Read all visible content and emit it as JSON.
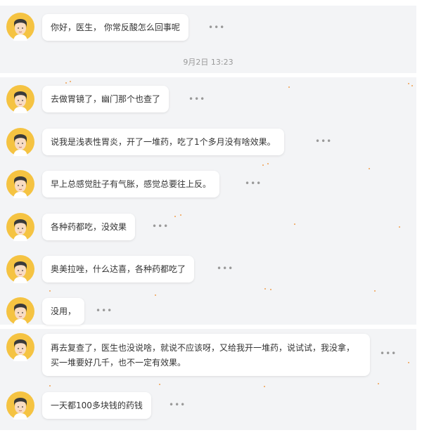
{
  "messages": [
    {
      "text": "你好，医生， 你常反酸怎么回事呢"
    },
    {
      "text": "去做胃镜了，幽门那个也查了"
    },
    {
      "text": "说我是浅表性胃炎，开了一堆药，吃了1个多月没有啥效果。"
    },
    {
      "text": "早上总感觉肚子有气胀，感觉总要往上反。"
    },
    {
      "text": "各种药都吃，没效果"
    },
    {
      "text": "奥美拉唑，什么达喜，各种药都吃了"
    },
    {
      "text": "没用，"
    },
    {
      "text": "再去复查了，医生也没说啥，就说不应该呀，又给我开一堆药，说试试，我没拿，买一堆要好几千，也不一定有效果。"
    },
    {
      "text": "一天都100多块钱的药钱"
    }
  ],
  "timestamp": "9月2日 13:23",
  "more_label": "•••",
  "colors": {
    "band": "#f3f4f6",
    "bubble": "#ffffff",
    "avatar_bg": "#f5c342",
    "accent_dot": "#f0a050"
  }
}
